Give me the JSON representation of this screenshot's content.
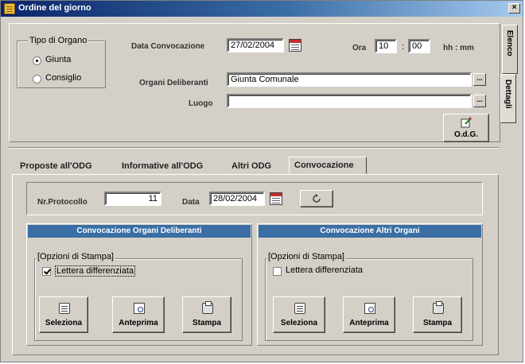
{
  "window": {
    "title": "Ordine del giorno",
    "close_label": "×"
  },
  "side_tabs": {
    "elenco": "Elenco",
    "dettagli": "Dettagli"
  },
  "tipo_organo": {
    "legend": "Tipo di Organo",
    "options": [
      {
        "label": "Giunta",
        "selected": true
      },
      {
        "label": "Consiglio",
        "selected": false
      }
    ]
  },
  "header": {
    "data_convocazione_label": "Data Convocazione",
    "data_convocazione_value": "27/02/2004",
    "ora_label": "Ora",
    "ora_hours": "10",
    "ora_sep": ":",
    "ora_minutes": "00",
    "ora_format": "hh : mm",
    "organi_label": "Organi Deliberanti",
    "organi_value": "Giunta Comunale",
    "luogo_label": "Luogo",
    "luogo_value": "",
    "odg_button_label": "O.d.G.",
    "ellipsis": "..."
  },
  "tabs": [
    {
      "label": "Proposte all'ODG",
      "active": false
    },
    {
      "label": "Informative all'ODG",
      "active": false
    },
    {
      "label": "Altri ODG",
      "active": false
    },
    {
      "label": "Convocazione",
      "active": true
    }
  ],
  "convocazione": {
    "protocollo_label": "Nr.Protocollo",
    "protocollo_value": "11",
    "data_label": "Data",
    "data_value": "28/02/2004"
  },
  "panels": [
    {
      "header": "Convocazione Organi Deliberanti",
      "options_legend": "[Opzioni di Stampa]",
      "checkbox_label": "Lettera differenziata",
      "checked": true,
      "buttons": [
        "Seleziona",
        "Anteprima",
        "Stampa"
      ]
    },
    {
      "header": "Convocazione Altri Organi",
      "options_legend": "[Opzioni di Stampa]",
      "checkbox_label": "Lettera differenziata",
      "checked": false,
      "buttons": [
        "Seleziona",
        "Anteprima",
        "Stampa"
      ]
    }
  ],
  "colors": {
    "titlebar": "#0a246a",
    "section_header": "#3a6ea5",
    "face": "#d4d0c8"
  }
}
